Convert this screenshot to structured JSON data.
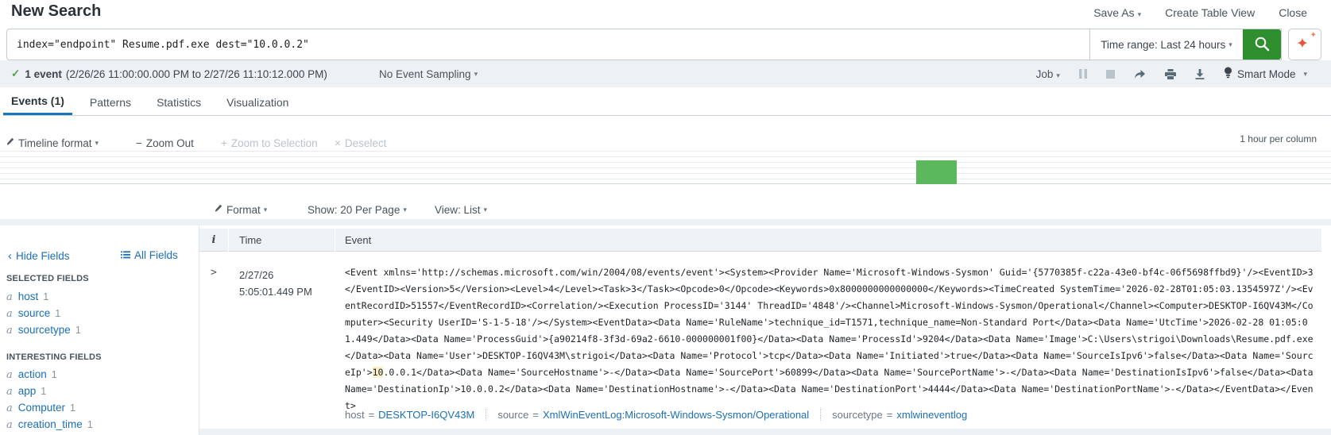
{
  "header": {
    "title": "New Search",
    "save_as": "Save As",
    "create_table_view": "Create Table View",
    "close": "Close"
  },
  "search": {
    "query": "index=\"endpoint\" Resume.pdf.exe dest=\"10.0.0.2\"",
    "time_range_label": "Time range: Last 24 hours"
  },
  "job_bar": {
    "event_count": "1 event",
    "time_span": "(2/26/26 11:00:00.000 PM to 2/27/26 11:10:12.000 PM)",
    "sampling": "No Event Sampling",
    "job_label": "Job",
    "smart_mode": "Smart Mode"
  },
  "tabs": [
    {
      "label": "Events (1)"
    },
    {
      "label": "Patterns"
    },
    {
      "label": "Statistics"
    },
    {
      "label": "Visualization"
    }
  ],
  "timeline": {
    "format_label": "Timeline format",
    "zoom_out": "Zoom Out",
    "zoom_to_selection": "Zoom to Selection",
    "deselect": "Deselect",
    "scale_note": "1 hour per column"
  },
  "results_controls": {
    "format": "Format",
    "per_page": "Show: 20 Per Page",
    "view": "View: List"
  },
  "fields_sidebar": {
    "hide_fields": "Hide Fields",
    "all_fields": "All Fields",
    "selected_header": "SELECTED FIELDS",
    "selected": [
      {
        "type": "a",
        "name": "host",
        "count": "1"
      },
      {
        "type": "a",
        "name": "source",
        "count": "1"
      },
      {
        "type": "a",
        "name": "sourcetype",
        "count": "1"
      }
    ],
    "interesting_header": "INTERESTING FIELDS",
    "interesting": [
      {
        "type": "a",
        "name": "action",
        "count": "1"
      },
      {
        "type": "a",
        "name": "app",
        "count": "1"
      },
      {
        "type": "a",
        "name": "Computer",
        "count": "1"
      },
      {
        "type": "a",
        "name": "creation_time",
        "count": "1"
      }
    ]
  },
  "events_table": {
    "col_info": "i",
    "col_time": "Time",
    "col_event": "Event",
    "row": {
      "date": "2/27/26",
      "time": "5:05:01.449 PM",
      "raw_before": "<Event xmlns='http://schemas.microsoft.com/win/2004/08/events/event'><System><Provider Name='Microsoft-Windows-Sysmon' Guid='{5770385f-c22a-43e0-bf4c-06f5698ffbd9}'/><EventID>3\n</EventID><Version>5</Version><Level>4</Level><Task>3</Task><Opcode>0</Opcode><Keywords>0x8000000000000000</Keywords><TimeCreated SystemTime='2026-02-28T01:05:03.1354597Z'/><Ev\nentRecordID>51557</EventRecordID><Correlation/><Execution ProcessID='3144' ThreadID='4848'/><Channel>Microsoft-Windows-Sysmon/Operational</Channel><Computer>DESKTOP-I6QV43M</Co\nmputer><Security UserID='S-1-5-18'/></System><EventData><Data Name='RuleName'>technique_id=T1571,technique_name=Non-Standard Port</Data><Data Name='UtcTime'>2026-02-28 01:05:0\n1.449</Data><Data Name='ProcessGuid'>{a90214f8-3f3d-69a2-6610-000000001f00}</Data><Data Name='ProcessId'>9204</Data><Data Name='Image'>C:\\Users\\strigoi\\Downloads\\Resume.pdf.exe\n</Data><Data Name='User'>DESKTOP-I6QV43M\\strigoi</Data><Data Name='Protocol'>tcp</Data><Data Name='Initiated'>true</Data><Data Name='SourceIsIpv6'>false</Data><Data Name='Sourc\neIp'>",
      "raw_highlight": "10",
      "raw_after": ".0.0.1</Data><Data Name='SourceHostname'>-</Data><Data Name='SourcePort'>60899</Data><Data Name='SourcePortName'>-</Data><Data Name='DestinationIsIpv6'>false</Data><Data\nName='DestinationIp'>10.0.0.2</Data><Data Name='DestinationHostname'>-</Data><Data Name='DestinationPort'>4444</Data><Data Name='DestinationPortName'>-</Data></EventData></Even\nt>",
      "fields": [
        {
          "key": "host",
          "value": "DESKTOP-I6QV43M"
        },
        {
          "key": "source",
          "value": "XmlWinEventLog:Microsoft-Windows-Sysmon/Operational"
        },
        {
          "key": "sourcetype",
          "value": "xmlwineventlog"
        }
      ]
    }
  }
}
